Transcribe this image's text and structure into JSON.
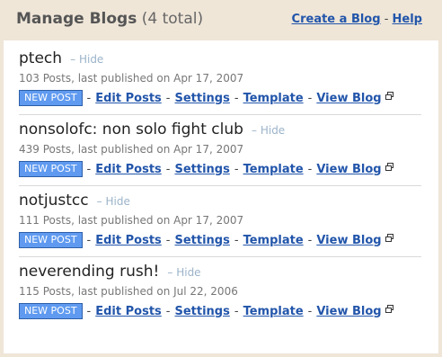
{
  "header": {
    "title": "Manage Blogs",
    "count": "(4 total)",
    "create_link": "Create a Blog",
    "divider": "-",
    "help_link": "Help"
  },
  "actions": {
    "new_post": "NEW POST",
    "edit_posts": "Edit Posts",
    "settings": "Settings",
    "template": "Template",
    "view_blog": "View Blog",
    "separator": "-",
    "hide": "– Hide"
  },
  "blogs": [
    {
      "name": "ptech",
      "meta": "103 Posts, last published on Apr 17, 2007"
    },
    {
      "name": "nonsolofc: non solo fight club",
      "meta": "439 Posts, last published on Apr 17, 2007"
    },
    {
      "name": "notjustcc",
      "meta": "111 Posts, last published on Apr 17, 2007"
    },
    {
      "name": "neverending rush!",
      "meta": "115 Posts, last published on Jul 22, 2006"
    }
  ],
  "colors": {
    "header_bg": "#efe6d8",
    "link": "#2255aa",
    "button_bg": "#5f9af0"
  }
}
